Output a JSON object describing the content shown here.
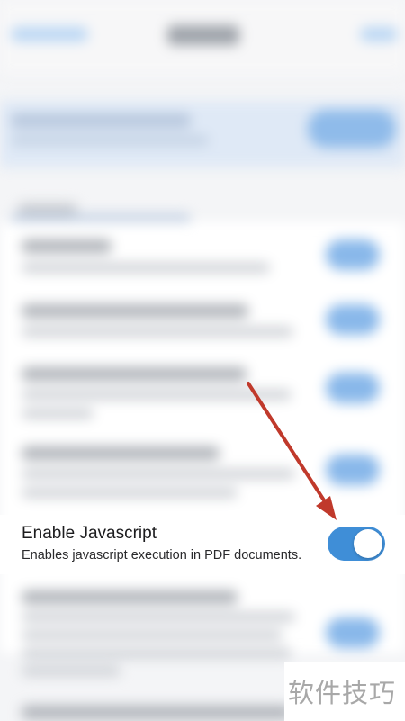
{
  "setting": {
    "title": "Enable Javascript",
    "description": "Enables javascript execution in PDF documents.",
    "toggle_state": "on"
  },
  "watermark": {
    "text": "软件技巧"
  },
  "colors": {
    "toggle_on": "#3f8ed7",
    "arrow": "#c0392b"
  }
}
